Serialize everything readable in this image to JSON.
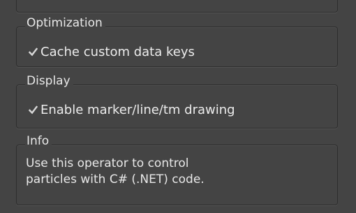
{
  "optimization": {
    "title": "Optimization",
    "cache_keys": {
      "label": "Cache custom data keys",
      "checked": true
    }
  },
  "display": {
    "title": "Display",
    "enable_drawing": {
      "label": "Enable marker/line/tm drawing",
      "checked": true
    }
  },
  "info": {
    "title": "Info",
    "lines": [
      "Use this operator to control",
      "particles with C# (.NET) code."
    ]
  },
  "colors": {
    "background": "#444444",
    "border": "#2e2e2e",
    "text": "#e8e8e8",
    "checkmark": "#d8d8d8"
  }
}
